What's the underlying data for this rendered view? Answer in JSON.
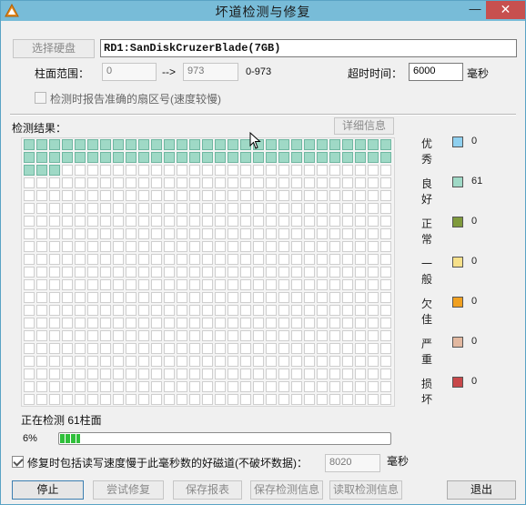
{
  "window": {
    "title": "坏道检测与修复",
    "minimize_glyph": "—",
    "close_glyph": "✕"
  },
  "drive_select": {
    "button_label": "选择硬盘",
    "drive_text": "RD1:SanDiskCruzerBlade(7GB)"
  },
  "range": {
    "label": "柱面范围：",
    "start_value": "0",
    "arrow": "-->",
    "end_value": "973",
    "range_text": "0-973"
  },
  "timeout": {
    "label": "超时时间：",
    "value": "6000",
    "unit": "毫秒"
  },
  "report_option": {
    "label": "检测时报告准确的扇区号(速度较慢)",
    "checked": false
  },
  "results": {
    "label": "检测结果：",
    "details_button": "详细信息"
  },
  "legend": [
    {
      "label": "优秀",
      "color": "#8fd0ef",
      "count": "0"
    },
    {
      "label": "良好",
      "color": "#9fd9c6",
      "count": "61"
    },
    {
      "label": "正常",
      "color": "#7f9a3c",
      "count": "0"
    },
    {
      "label": "一般",
      "color": "#f6e08a",
      "count": "0"
    },
    {
      "label": "欠佳",
      "color": "#f0a020",
      "count": "0"
    },
    {
      "label": "严重",
      "color": "#e2b8a0",
      "count": "0"
    },
    {
      "label": "损坏",
      "color": "#c8484a",
      "count": "0"
    }
  ],
  "grid": {
    "columns": 29,
    "rows": 21,
    "good_cells": 61
  },
  "status": {
    "text": "正在检测 61柱面",
    "percent_text": "6%",
    "progress": 0.06
  },
  "repair_option": {
    "label": "修复时包括读写速度慢于此毫秒数的好磁道(不破坏数据)：",
    "checked": true,
    "value": "8020",
    "unit": "毫秒"
  },
  "buttons": {
    "stop": "停止",
    "try_repair": "尝试修复",
    "save_report": "保存报表",
    "save_info": "保存检测信息",
    "read_info": "读取检测信息",
    "exit": "退出"
  }
}
